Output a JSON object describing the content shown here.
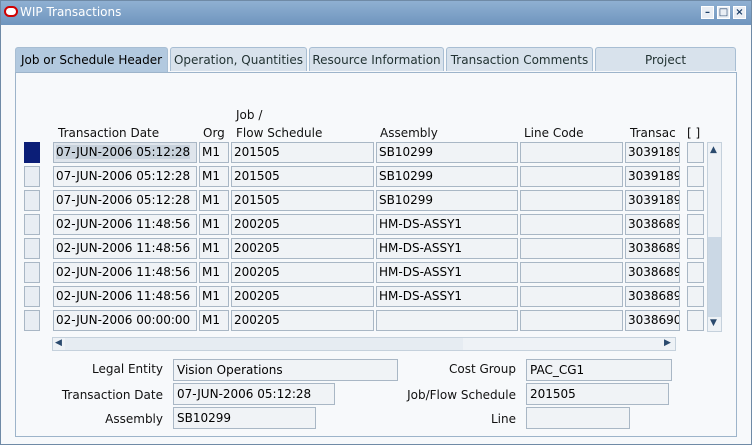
{
  "window": {
    "title": "WIP Transactions"
  },
  "tabs": [
    {
      "label": "Job or Schedule Header"
    },
    {
      "label": "Operation, Quantities"
    },
    {
      "label": "Resource Information"
    },
    {
      "label": "Transaction Comments"
    },
    {
      "label": "Project"
    }
  ],
  "table": {
    "headers": {
      "date": "Transaction Date",
      "org": "Org",
      "job1": "Job /",
      "job2": "Flow Schedule",
      "assembly": "Assembly",
      "line": "Line Code",
      "transaction": "Transac",
      "extra": "[ ]"
    },
    "rows": [
      {
        "date": "07-JUN-2006 05:12:28",
        "org": "M1",
        "job": "201505",
        "assembly": "SB10299",
        "line": "",
        "transaction": "3039189"
      },
      {
        "date": "07-JUN-2006 05:12:28",
        "org": "M1",
        "job": "201505",
        "assembly": "SB10299",
        "line": "",
        "transaction": "3039189"
      },
      {
        "date": "07-JUN-2006 05:12:28",
        "org": "M1",
        "job": "201505",
        "assembly": "SB10299",
        "line": "",
        "transaction": "3039189"
      },
      {
        "date": "02-JUN-2006 11:48:56",
        "org": "M1",
        "job": "200205",
        "assembly": "HM-DS-ASSY1",
        "line": "",
        "transaction": "3038689"
      },
      {
        "date": "02-JUN-2006 11:48:56",
        "org": "M1",
        "job": "200205",
        "assembly": "HM-DS-ASSY1",
        "line": "",
        "transaction": "3038689"
      },
      {
        "date": "02-JUN-2006 11:48:56",
        "org": "M1",
        "job": "200205",
        "assembly": "HM-DS-ASSY1",
        "line": "",
        "transaction": "3038689"
      },
      {
        "date": "02-JUN-2006 11:48:56",
        "org": "M1",
        "job": "200205",
        "assembly": "HM-DS-ASSY1",
        "line": "",
        "transaction": "3038689"
      },
      {
        "date": "02-JUN-2006 00:00:00",
        "org": "M1",
        "job": "200205",
        "assembly": "",
        "line": "",
        "transaction": "3038690"
      }
    ]
  },
  "details": {
    "legal_entity_label": "Legal Entity",
    "legal_entity": "Vision Operations",
    "cost_group_label": "Cost Group",
    "cost_group": "PAC_CG1",
    "transaction_date_label": "Transaction Date",
    "transaction_date": "07-JUN-2006 05:12:28",
    "job_label": "Job/Flow Schedule",
    "job": "201505",
    "assembly_label": "Assembly",
    "assembly": "SB10299",
    "line_label": "Line",
    "line": ""
  },
  "colors": {
    "accent": "#0b1e77",
    "titlebar": "#7a9dc4",
    "tab_active": "#b2c9df"
  },
  "icons": {
    "app": "oracle-icon",
    "minimize": "minimize-icon",
    "maximize": "maximize-icon",
    "close": "close-icon"
  }
}
